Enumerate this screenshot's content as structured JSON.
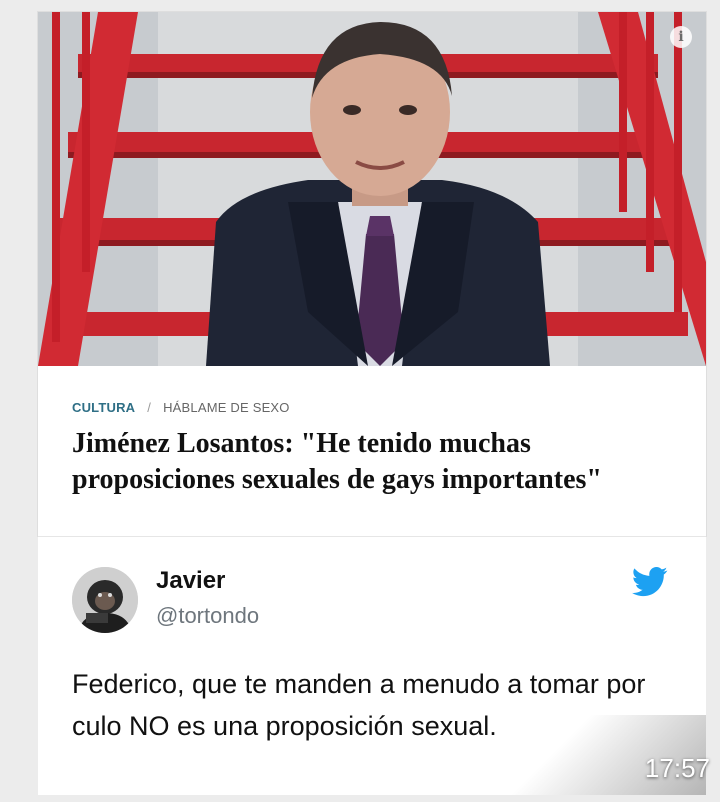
{
  "article": {
    "category": "CULTURA",
    "separator": "/",
    "subcategory": "HÁBLAME DE SEXO",
    "headline": "Jiménez Losantos: \"He tenido muchas proposiciones sexuales de gays importantes\"",
    "info_icon": "info-icon"
  },
  "tweet": {
    "author": "Javier",
    "handle": "@tortondo",
    "text": "Federico, que te manden a menudo a tomar por culo NO es una proposición sexual.",
    "brand_icon": "twitter-bird-icon",
    "brand_color": "#1DA1F2"
  },
  "overlay": {
    "time": "17:57"
  }
}
